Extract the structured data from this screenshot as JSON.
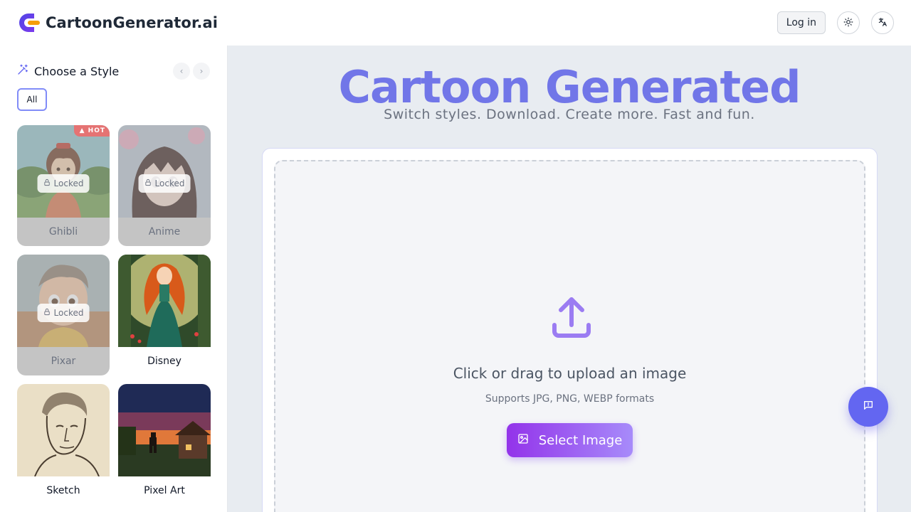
{
  "header": {
    "brand_name": "CartoonGenerator.ai",
    "login_label": "Log in",
    "theme_icon": "sun-icon",
    "language_icon": "translate-icon"
  },
  "sidebar": {
    "title": "Choose a Style",
    "filters": [
      {
        "label": "All",
        "active": true
      }
    ],
    "styles": [
      {
        "label": "Ghibli",
        "locked": true,
        "lock_label": "Locked",
        "badge": "HOT"
      },
      {
        "label": "Anime",
        "locked": true,
        "lock_label": "Locked"
      },
      {
        "label": "Pixar",
        "locked": true,
        "lock_label": "Locked"
      },
      {
        "label": "Disney",
        "locked": false
      },
      {
        "label": "Sketch",
        "locked": false
      },
      {
        "label": "Pixel Art",
        "locked": false
      }
    ]
  },
  "main": {
    "title": "Cartoon Generated",
    "subtitle": "Switch styles. Download. Create more. Fast and fun.",
    "upload": {
      "prompt": "Click or drag to upload an image",
      "formats": "Supports JPG, PNG, WEBP formats",
      "button_label": "Select Image"
    }
  },
  "colors": {
    "accent": "#6366f1",
    "title": "#7176e8",
    "button_gradient_start": "#9333ea",
    "button_gradient_end": "#a78bfa"
  }
}
